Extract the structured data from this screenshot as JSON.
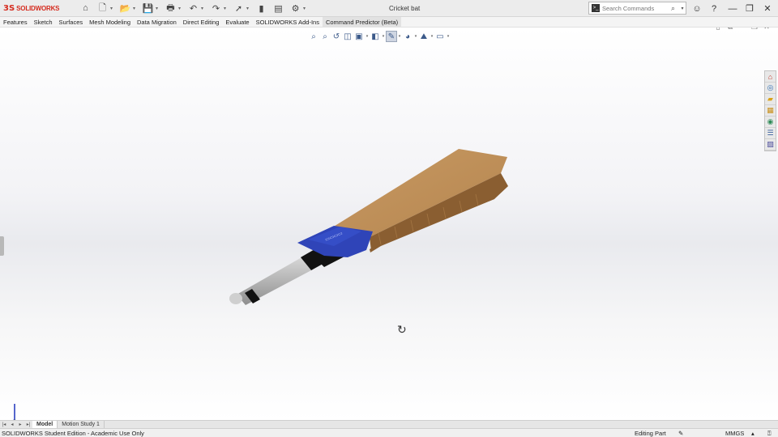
{
  "app": {
    "logo_mark": "3S",
    "logo_text": "SOLIDWORKS",
    "document_title": "Cricket bat"
  },
  "quick_access": [
    {
      "icon": "home-icon",
      "glyph": "⌂",
      "has_dropdown": false
    },
    {
      "icon": "new-document-icon",
      "glyph": "🗋",
      "has_dropdown": true
    },
    {
      "icon": "open-icon",
      "glyph": "📂",
      "has_dropdown": true
    },
    {
      "icon": "save-icon",
      "glyph": "💾",
      "has_dropdown": true
    },
    {
      "icon": "print-icon",
      "glyph": "🖶",
      "has_dropdown": true
    },
    {
      "icon": "undo-icon",
      "glyph": "↶",
      "has_dropdown": true
    },
    {
      "icon": "redo-icon",
      "glyph": "↷",
      "has_dropdown": true
    },
    {
      "icon": "select-pointer-icon",
      "glyph": "➚",
      "has_dropdown": true
    },
    {
      "icon": "rebuild-traffic-light-icon",
      "glyph": "▮",
      "has_dropdown": false
    },
    {
      "icon": "file-properties-icon",
      "glyph": "▤",
      "has_dropdown": false
    },
    {
      "icon": "options-gear-icon",
      "glyph": "⚙",
      "has_dropdown": true
    }
  ],
  "search": {
    "placeholder": "Search Commands",
    "prompt_glyph": ">_",
    "search_glyph": "⌕",
    "dropdown_glyph": "▾"
  },
  "window_controls": {
    "account_glyph": "☺",
    "help_glyph": "?",
    "minimize_glyph": "—",
    "restore_glyph": "❐",
    "close_glyph": "✕"
  },
  "menu_tabs": [
    {
      "label": "Features",
      "active": false
    },
    {
      "label": "Sketch",
      "active": false
    },
    {
      "label": "Surfaces",
      "active": false
    },
    {
      "label": "Mesh Modeling",
      "active": false
    },
    {
      "label": "Data Migration",
      "active": false
    },
    {
      "label": "Direct Editing",
      "active": false
    },
    {
      "label": "Evaluate",
      "active": false
    },
    {
      "label": "SOLIDWORKS Add-Ins",
      "active": false
    },
    {
      "label": "Command Predictor (Beta)",
      "active": true
    }
  ],
  "view_toolbar": [
    {
      "icon": "zoom-to-fit-icon",
      "glyph": "⌕",
      "has_dropdown": false,
      "selected": false
    },
    {
      "icon": "zoom-to-area-icon",
      "glyph": "⌕",
      "has_dropdown": false,
      "selected": false
    },
    {
      "icon": "previous-view-icon",
      "glyph": "↺",
      "has_dropdown": false,
      "selected": false
    },
    {
      "icon": "section-view-icon",
      "glyph": "◫",
      "has_dropdown": false,
      "selected": false
    },
    {
      "icon": "view-orientation-icon",
      "glyph": "▣",
      "has_dropdown": true,
      "selected": false
    },
    {
      "icon": "display-style-icon",
      "glyph": "◧",
      "has_dropdown": true,
      "selected": false
    },
    {
      "icon": "hide-show-items-icon",
      "glyph": "✎",
      "has_dropdown": true,
      "selected": true
    },
    {
      "icon": "edit-appearance-icon",
      "glyph": "◕",
      "has_dropdown": true,
      "selected": false
    },
    {
      "icon": "apply-scene-icon",
      "glyph": "⛰",
      "has_dropdown": true,
      "selected": false
    },
    {
      "icon": "view-settings-icon",
      "glyph": "▭",
      "has_dropdown": true,
      "selected": false
    }
  ],
  "viewport_controls": {
    "collapse_glyph": "▯",
    "tile_glyph": "⧉",
    "restore_glyph": "❐",
    "close_glyph": "✕"
  },
  "task_pane": [
    {
      "icon": "solidworks-resources-icon",
      "glyph": "⌂"
    },
    {
      "icon": "design-library-icon",
      "glyph": "◎"
    },
    {
      "icon": "file-explorer-icon",
      "glyph": "▰"
    },
    {
      "icon": "view-palette-icon",
      "glyph": "▦"
    },
    {
      "icon": "appearances-scenes-icon",
      "glyph": "◉"
    },
    {
      "icon": "custom-properties-icon",
      "glyph": "☰"
    },
    {
      "icon": "solidworks-forum-icon",
      "glyph": "▨"
    }
  ],
  "model": {
    "colors": {
      "blade_top": "#b5854f",
      "blade_side": "#8a5e31",
      "blade_edge": "#c89a63",
      "sticker_blue": "#2f44b8",
      "handle_gray": "#a9a9a9",
      "grip_black": "#121212"
    }
  },
  "model_tabs": [
    {
      "label": "Model",
      "active": true
    },
    {
      "label": "Motion Study 1",
      "active": false
    }
  ],
  "model_tab_nav": [
    "|◂",
    "◂",
    "▸",
    "▸|"
  ],
  "status_bar": {
    "edition": "SOLIDWORKS Student Edition - Academic Use Only",
    "mode": "Editing Part",
    "units": "MMGS",
    "units_dropdown_glyph": "▴",
    "rebuild_glyph": "✎",
    "help_glyph": "⍰"
  }
}
